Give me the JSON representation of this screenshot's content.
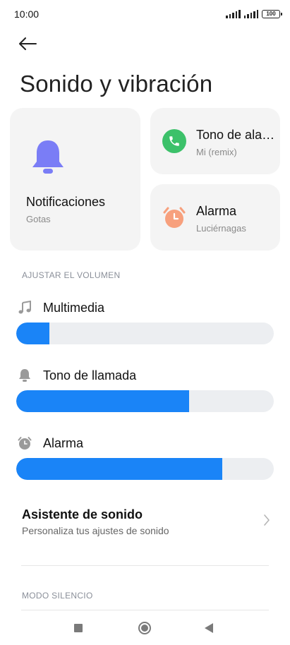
{
  "status_bar": {
    "time": "10:00",
    "battery": "100"
  },
  "header": {
    "title": "Sonido y vibración"
  },
  "cards": {
    "notifications": {
      "title": "Notificaciones",
      "subtitle": "Gotas",
      "icon": "bell-icon",
      "color": "#7a7df6"
    },
    "ringtone": {
      "title": "Tono de alarma",
      "subtitle": "Mi (remix)",
      "icon": "phone-icon",
      "color": "#3cc16a"
    },
    "alarm": {
      "title": "Alarma",
      "subtitle": "Luciérnagas",
      "icon": "alarm-clock-icon",
      "color": "#f7a07d"
    }
  },
  "volume": {
    "section_header": "AJUSTAR EL VOLUMEN",
    "sliders": [
      {
        "label": "Multimedia",
        "icon": "music-note-icon",
        "level": 0.13
      },
      {
        "label": "Tono de llamada",
        "icon": "bell-icon",
        "level": 0.67
      },
      {
        "label": "Alarma",
        "icon": "alarm-clock-icon",
        "level": 0.8
      }
    ],
    "accent": "#1a84f7"
  },
  "sound_assistant": {
    "title": "Asistente de sonido",
    "subtitle": "Personaliza tus ajustes de sonido"
  },
  "silent_mode": {
    "section_header": "MODO SILENCIO"
  }
}
